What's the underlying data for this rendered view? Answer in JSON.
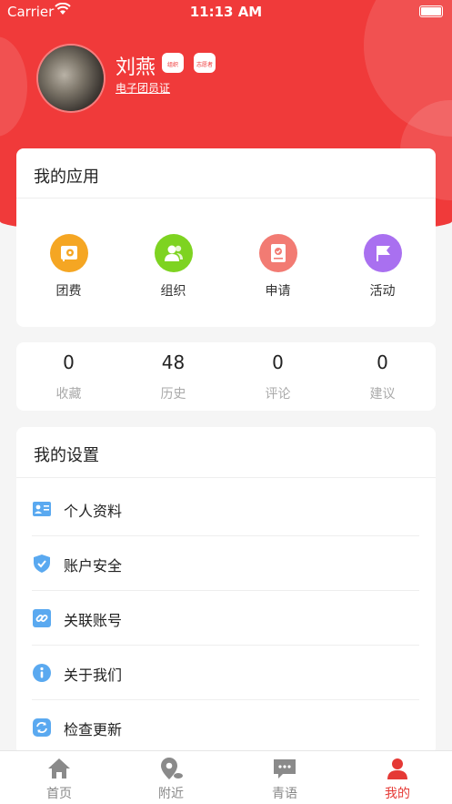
{
  "status": {
    "carrier": "Carrier",
    "time": "11:13 AM"
  },
  "profile": {
    "name": "刘燕",
    "badges": [
      {
        "text": "组织"
      },
      {
        "text": "志愿者"
      }
    ],
    "id_link": "电子团员证"
  },
  "apps": {
    "title": "我的应用",
    "items": [
      {
        "label": "团费",
        "icon": "flag-star-icon",
        "color": "#f5a623"
      },
      {
        "label": "组织",
        "icon": "users-icon",
        "color": "#7ed321"
      },
      {
        "label": "申请",
        "icon": "document-check-icon",
        "color": "#f27b73"
      },
      {
        "label": "活动",
        "icon": "flag-icon",
        "color": "#a970f0"
      }
    ]
  },
  "stats": [
    {
      "value": "0",
      "label": "收藏"
    },
    {
      "value": "48",
      "label": "历史"
    },
    {
      "value": "0",
      "label": "评论"
    },
    {
      "value": "0",
      "label": "建议"
    }
  ],
  "settings": {
    "title": "我的设置",
    "items": [
      {
        "label": "个人资料",
        "icon": "id-card-icon"
      },
      {
        "label": "账户安全",
        "icon": "shield-icon"
      },
      {
        "label": "关联账号",
        "icon": "link-icon"
      },
      {
        "label": "关于我们",
        "icon": "info-icon"
      },
      {
        "label": "检查更新",
        "icon": "refresh-icon"
      }
    ]
  },
  "tabs": [
    {
      "label": "首页",
      "icon": "home-icon"
    },
    {
      "label": "附近",
      "icon": "location-icon"
    },
    {
      "label": "青语",
      "icon": "chat-icon"
    },
    {
      "label": "我的",
      "icon": "person-icon",
      "active": true
    }
  ],
  "colors": {
    "primary": "#f03a3a",
    "tab_active": "#e53935",
    "settings_icon": "#5aa9f0"
  }
}
